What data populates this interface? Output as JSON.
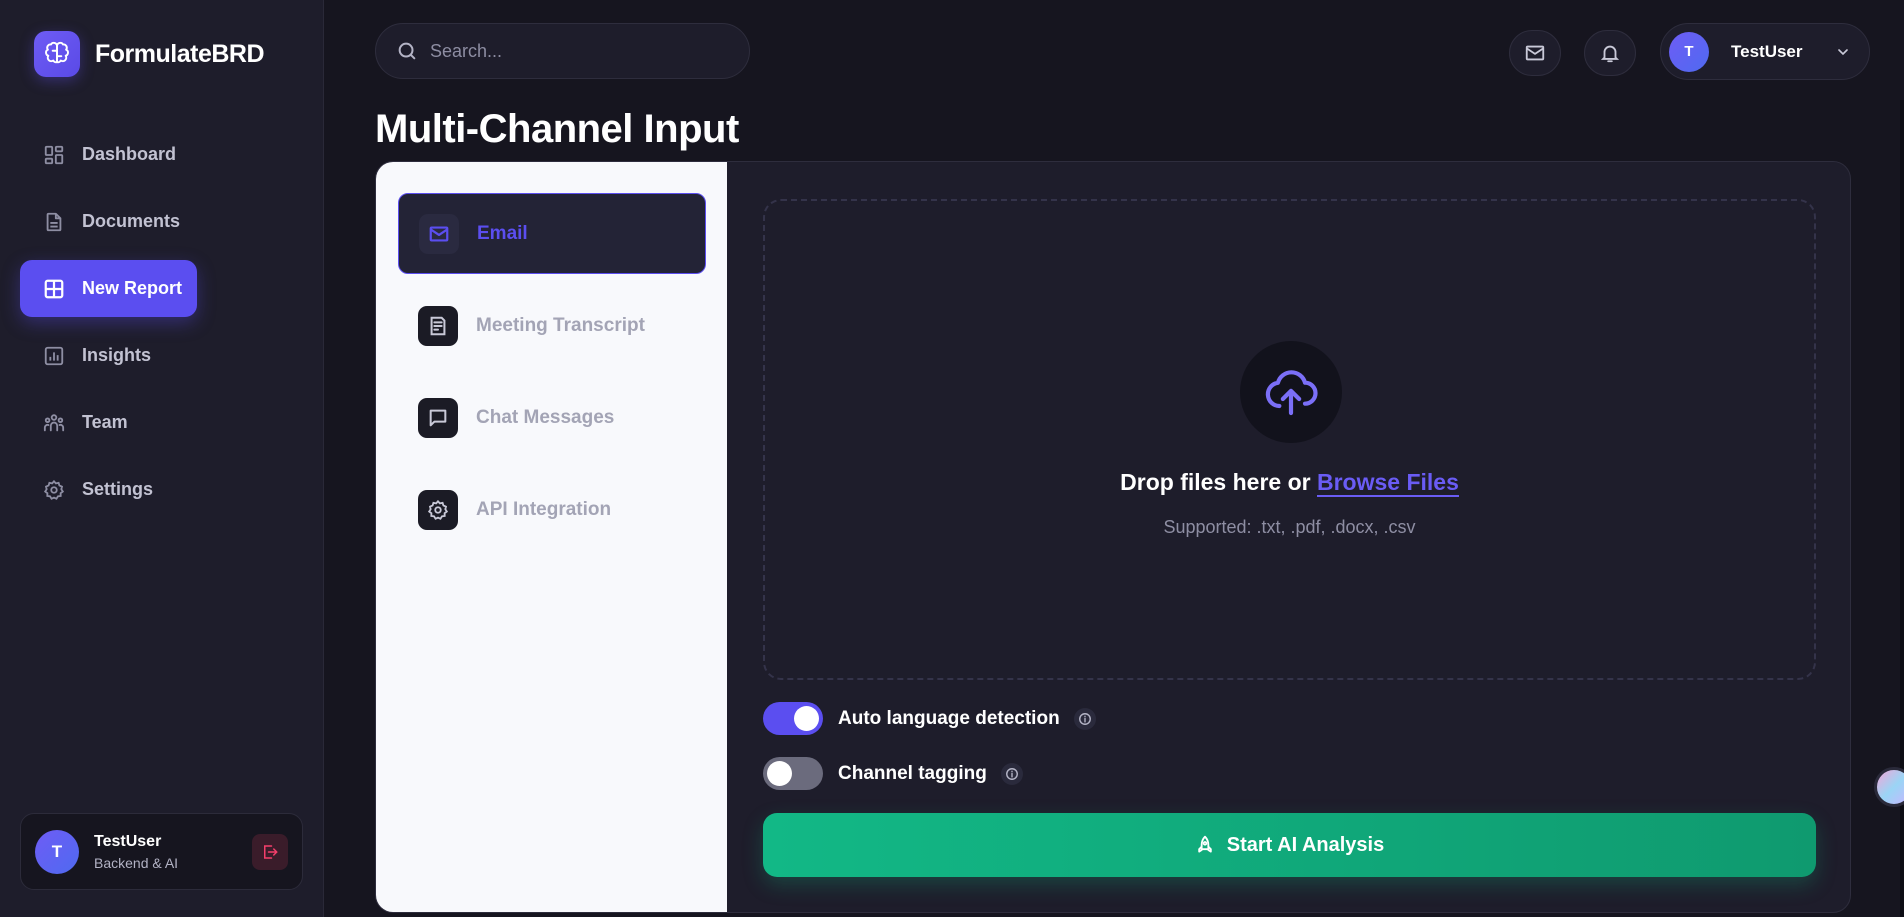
{
  "brand": {
    "name": "FormulateBRD",
    "logo_icon": "brain-icon",
    "accent": "#5b4ef0"
  },
  "sidebar": {
    "items": [
      {
        "label": "Dashboard",
        "icon": "dashboard-icon",
        "active": false
      },
      {
        "label": "Documents",
        "icon": "document-icon",
        "active": false
      },
      {
        "label": "New Report",
        "icon": "grid-plus-icon",
        "active": true
      },
      {
        "label": "Insights",
        "icon": "bar-chart-icon",
        "active": false
      },
      {
        "label": "Team",
        "icon": "team-icon",
        "active": false
      },
      {
        "label": "Settings",
        "icon": "gear-icon",
        "active": false
      }
    ],
    "user": {
      "initial": "T",
      "name": "TestUser",
      "role": "Backend & AI"
    }
  },
  "header": {
    "search_placeholder": "Search...",
    "profile": {
      "initial": "T",
      "name": "TestUser"
    }
  },
  "page": {
    "title": "Multi-Channel Input"
  },
  "channels": [
    {
      "label": "Email",
      "icon": "mail-icon",
      "active": true
    },
    {
      "label": "Meeting Transcript",
      "icon": "transcript-icon",
      "active": false
    },
    {
      "label": "Chat Messages",
      "icon": "chat-icon",
      "active": false
    },
    {
      "label": "API Integration",
      "icon": "api-gear-icon",
      "active": false
    }
  ],
  "upload": {
    "drop_text": "Drop files here or",
    "browse_label": "Browse Files",
    "supported": "Supported: .txt, .pdf, .docx, .csv"
  },
  "options": [
    {
      "label": "Auto language detection",
      "enabled": true
    },
    {
      "label": "Channel tagging",
      "enabled": false
    }
  ],
  "action": {
    "start_label": "Start AI Analysis",
    "color": "#12b886"
  }
}
